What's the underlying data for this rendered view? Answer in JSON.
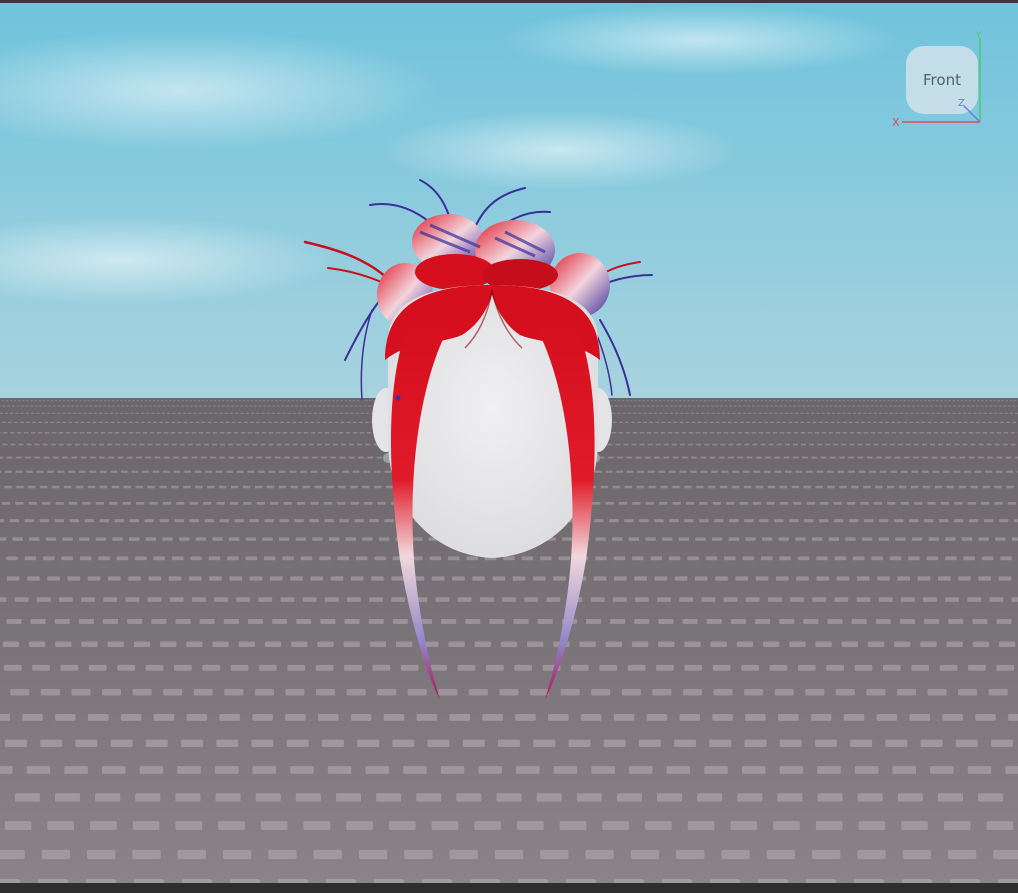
{
  "viewport": {
    "sky_color_top": "#6fc3dc",
    "sky_color_bottom": "#a5d2df",
    "floor_color": "#7a7479",
    "stud_color": "#a39ca2"
  },
  "view_cube": {
    "face_label": "Front",
    "axis_x_label": "X",
    "axis_y_label": "Y",
    "axis_z_label": "Z",
    "axis_x_color": "#e04a5a",
    "axis_y_color": "#4ec96a",
    "axis_z_color": "#6a7ee0"
  },
  "model": {
    "hair_primary_color": "#d8101e",
    "hair_secondary_color": "#3b2f9a",
    "head_color": "#e9e9eb"
  }
}
